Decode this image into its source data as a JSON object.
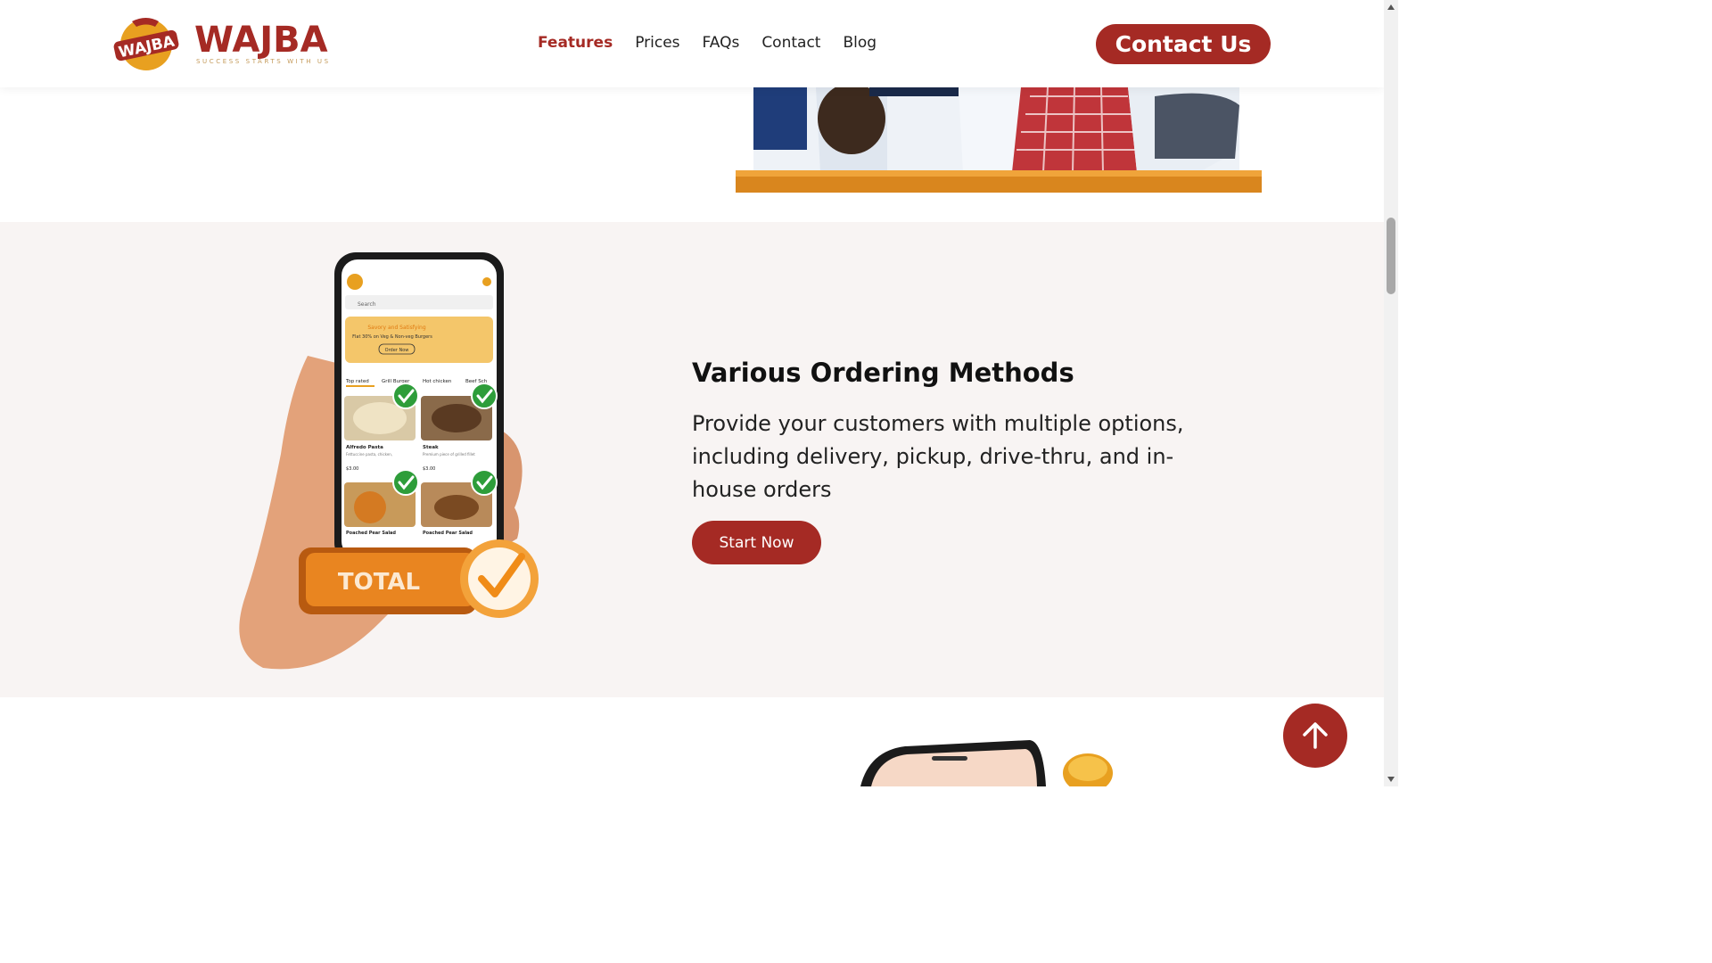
{
  "brand": {
    "name": "WAJBA",
    "badge_text": "WAJBA",
    "tagline": "SUCCESS STARTS WITH US",
    "primary_color": "#a52a24",
    "accent_color": "#e8a020"
  },
  "nav": {
    "items": [
      {
        "label": "Features",
        "active": true
      },
      {
        "label": "Prices",
        "active": false
      },
      {
        "label": "FAQs",
        "active": false
      },
      {
        "label": "Contact",
        "active": false
      },
      {
        "label": "Blog",
        "active": false
      }
    ],
    "cta_label": "Contact Us"
  },
  "feature": {
    "title": "Various Ordering Methods",
    "description": "Provide your customers with multiple options, including delivery, pickup, drive-thru, and in-house orders",
    "button_label": "Start Now",
    "illustration": {
      "search_placeholder": "Search",
      "promo_title": "Savory and Satisfying",
      "promo_text": "Flat 30% on Veg & Non-veg Burgers",
      "promo_button": "Order Now",
      "categories": [
        "Top rated",
        "Grill Burger",
        "Hot chicken",
        "Beef Sch"
      ],
      "items": [
        {
          "name": "Alfredo Pasta",
          "desc": "Fettuccine pasta, chicken, mushroom, white sauce and parmigan cheese",
          "price": "$3.00"
        },
        {
          "name": "Steak",
          "desc": "Premium piece of grilled fillet and your choice of sauce.",
          "price": "$3.00"
        },
        {
          "name": "Poached Pear Salad",
          "desc": "",
          "price": ""
        },
        {
          "name": "Poached Pear Salad",
          "desc": "",
          "price": ""
        }
      ],
      "total_label": "TOTAL"
    }
  },
  "icons": {
    "scroll_top": "arrow-up-icon",
    "scrollbar_up": "triangle-up-icon",
    "scrollbar_down": "triangle-down-icon"
  }
}
